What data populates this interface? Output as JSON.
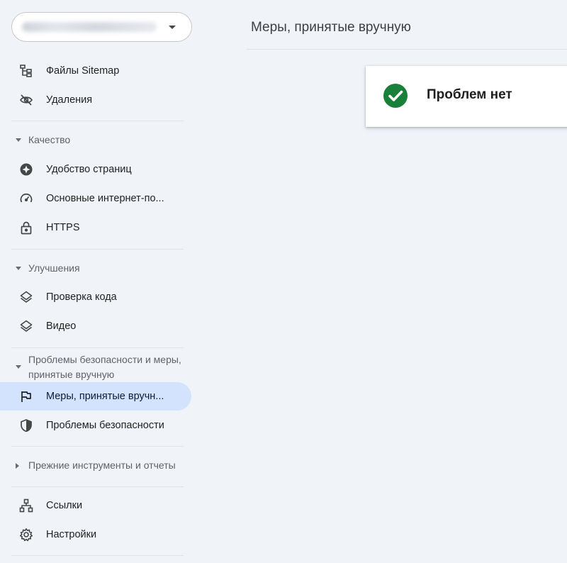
{
  "property_selector": {
    "value": ""
  },
  "sidebar": {
    "top_items": [
      {
        "label": "Файлы Sitemap",
        "icon": "sitemap-icon"
      },
      {
        "label": "Удаления",
        "icon": "eye-off-icon"
      }
    ],
    "sections": [
      {
        "title": "Качество",
        "expanded": true,
        "items": [
          {
            "label": "Удобство страниц",
            "icon": "page-experience-icon"
          },
          {
            "label": "Основные интернет-по...",
            "icon": "gauge-icon"
          },
          {
            "label": "HTTPS",
            "icon": "lock-icon"
          }
        ]
      },
      {
        "title": "Улучшения",
        "expanded": true,
        "items": [
          {
            "label": "Проверка кода",
            "icon": "layers-icon"
          },
          {
            "label": "Видео",
            "icon": "layers-icon"
          }
        ]
      },
      {
        "title": "Проблемы безопасности и меры, принятые вручную",
        "expanded": true,
        "items": [
          {
            "label": "Меры, принятые вручн...",
            "icon": "flag-icon",
            "active": true
          },
          {
            "label": "Проблемы безопасности",
            "icon": "shield-icon"
          }
        ]
      },
      {
        "title": "Прежние инструменты и отчеты",
        "expanded": false,
        "items": []
      }
    ],
    "bottom_items": [
      {
        "label": "Ссылки",
        "icon": "links-icon"
      },
      {
        "label": "Настройки",
        "icon": "gear-icon"
      }
    ]
  },
  "main": {
    "page_title": "Меры, принятые вручную",
    "status": {
      "text": "Проблем нет",
      "icon": "check-circle-icon",
      "color": "#188038"
    }
  },
  "colors": {
    "background": "#f0f4f9",
    "active_item": "#d3e3fd",
    "icon": "#444746"
  }
}
